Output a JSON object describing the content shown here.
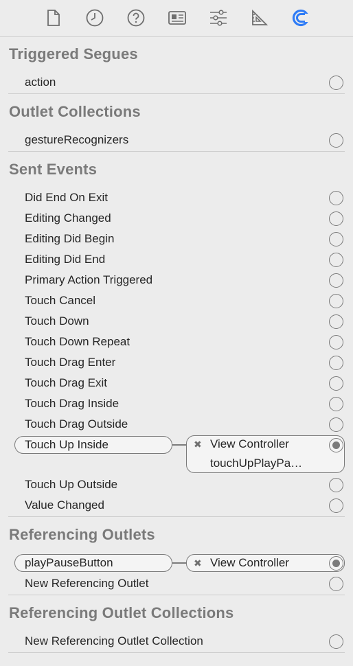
{
  "toolbar": {
    "icons": [
      "file-icon",
      "history-icon",
      "help-icon",
      "identity-icon",
      "attributes-icon",
      "size-icon",
      "connections-icon"
    ],
    "active_color": "#2f7cf6",
    "icon_color": "#6e6e6e"
  },
  "sections": {
    "triggered_segues": {
      "title": "Triggered Segues",
      "rows": [
        "action"
      ]
    },
    "outlet_collections": {
      "title": "Outlet Collections",
      "rows": [
        "gestureRecognizers"
      ]
    },
    "sent_events": {
      "title": "Sent Events",
      "rows": [
        "Did End On Exit",
        "Editing Changed",
        "Editing Did Begin",
        "Editing Did End",
        "Primary Action Triggered",
        "Touch Cancel",
        "Touch Down",
        "Touch Down Repeat",
        "Touch Drag Enter",
        "Touch Drag Exit",
        "Touch Drag Inside",
        "Touch Drag Outside"
      ],
      "connected": {
        "event": "Touch Up Inside",
        "target": "View Controller",
        "method": "touchUpPlayPa…"
      },
      "rows_after": [
        "Touch Up Outside",
        "Value Changed"
      ]
    },
    "referencing_outlets": {
      "title": "Referencing Outlets",
      "connected": {
        "outlet": "playPauseButton",
        "target": "View Controller"
      },
      "rows": [
        "New Referencing Outlet"
      ]
    },
    "referencing_outlet_collections": {
      "title": "Referencing Outlet Collections",
      "rows": [
        "New Referencing Outlet Collection"
      ]
    }
  },
  "remove_glyph": "✖"
}
